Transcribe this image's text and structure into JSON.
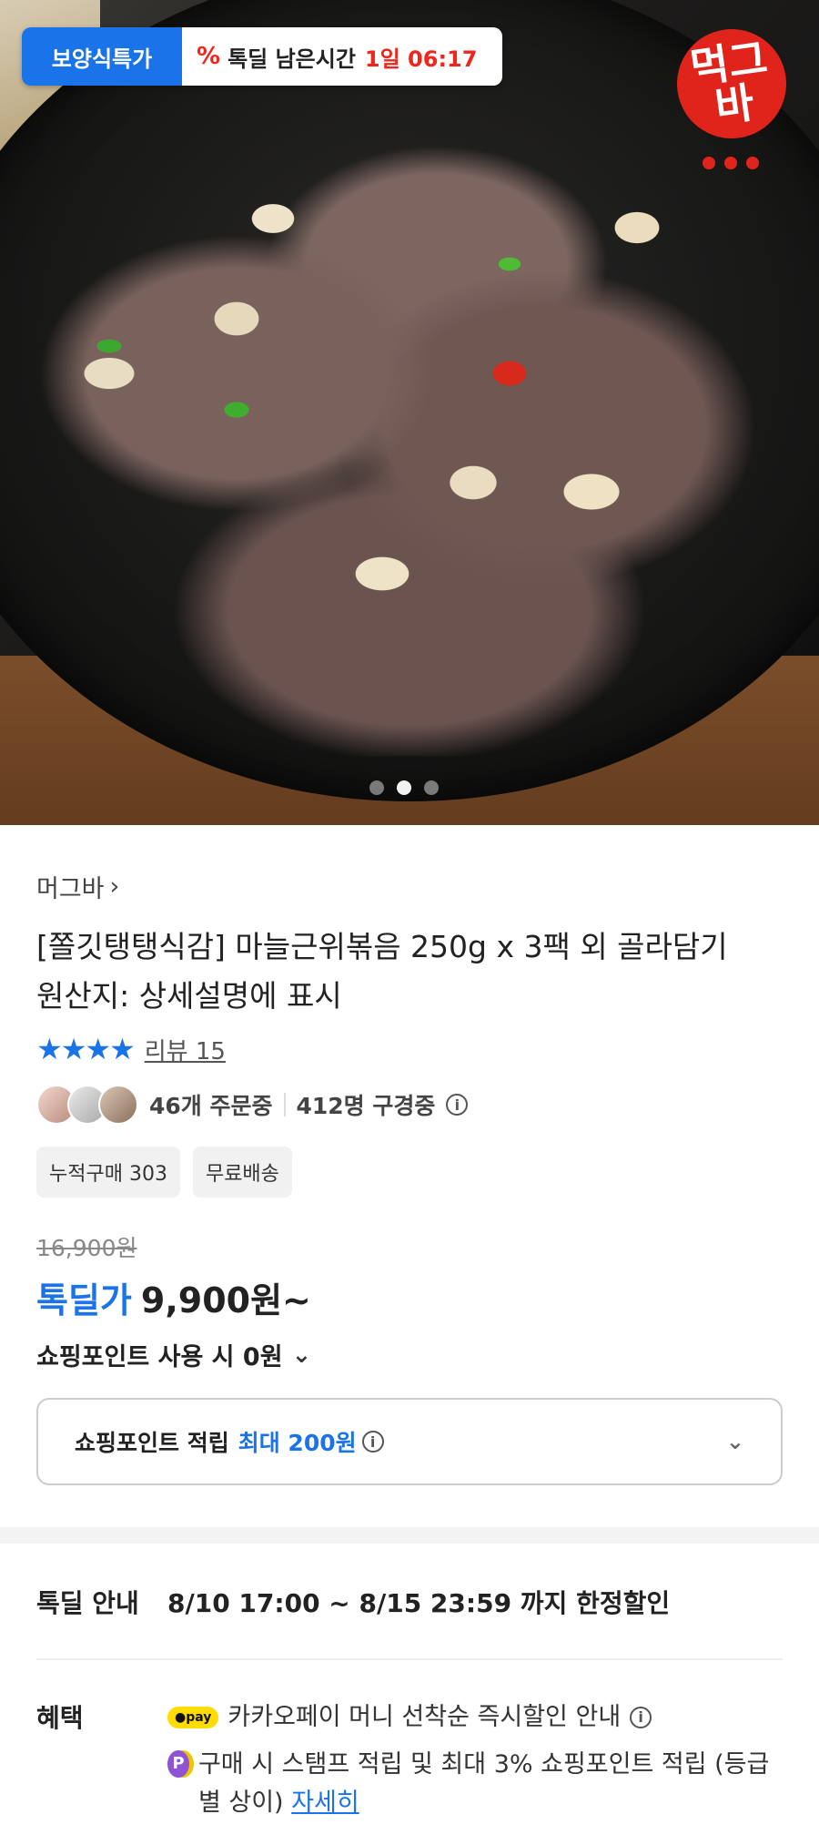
{
  "hero": {
    "badge_category": "보양식특가",
    "badge_prefix": "톡딜 남은시간",
    "badge_time": "1일 06:17",
    "brand_logo_text": "먹그바",
    "pager": {
      "count": 3,
      "active": 1
    }
  },
  "product": {
    "seller": "머그바",
    "title_line1": "[쫄깃탱탱식감] 마늘근위볶음 250g x 3팩 외 골라담기",
    "title_line2": "원산지: 상세설명에 표시",
    "stars": "★★★★",
    "review_label": "리뷰 15",
    "orders": "46개 주문중",
    "viewers": "412명 구경중",
    "chips": [
      "누적구매 303",
      "무료배송"
    ],
    "original_price": "16,900원",
    "sale_label": "톡딜가",
    "sale_price": "9,900원~",
    "points_use": "쇼핑포인트 사용 시 0원",
    "points_accum_label": "쇼핑포인트 적립",
    "points_accum_max": "최대 200원"
  },
  "deal": {
    "info_label": "톡딜 안내",
    "info_value": "8/10 17:00 ~ 8/15 23:59 까지 한정할인",
    "benefit_label": "혜택",
    "benefits": [
      {
        "icon": "pay",
        "text": "카카오페이 머니 선착순 즉시할인 안내"
      },
      {
        "icon": "P",
        "text": "구매 시 스탬프 적립 및 최대 3% 쇼핑포인트 적립 (등급별 상이)",
        "link": "자세히"
      }
    ]
  }
}
